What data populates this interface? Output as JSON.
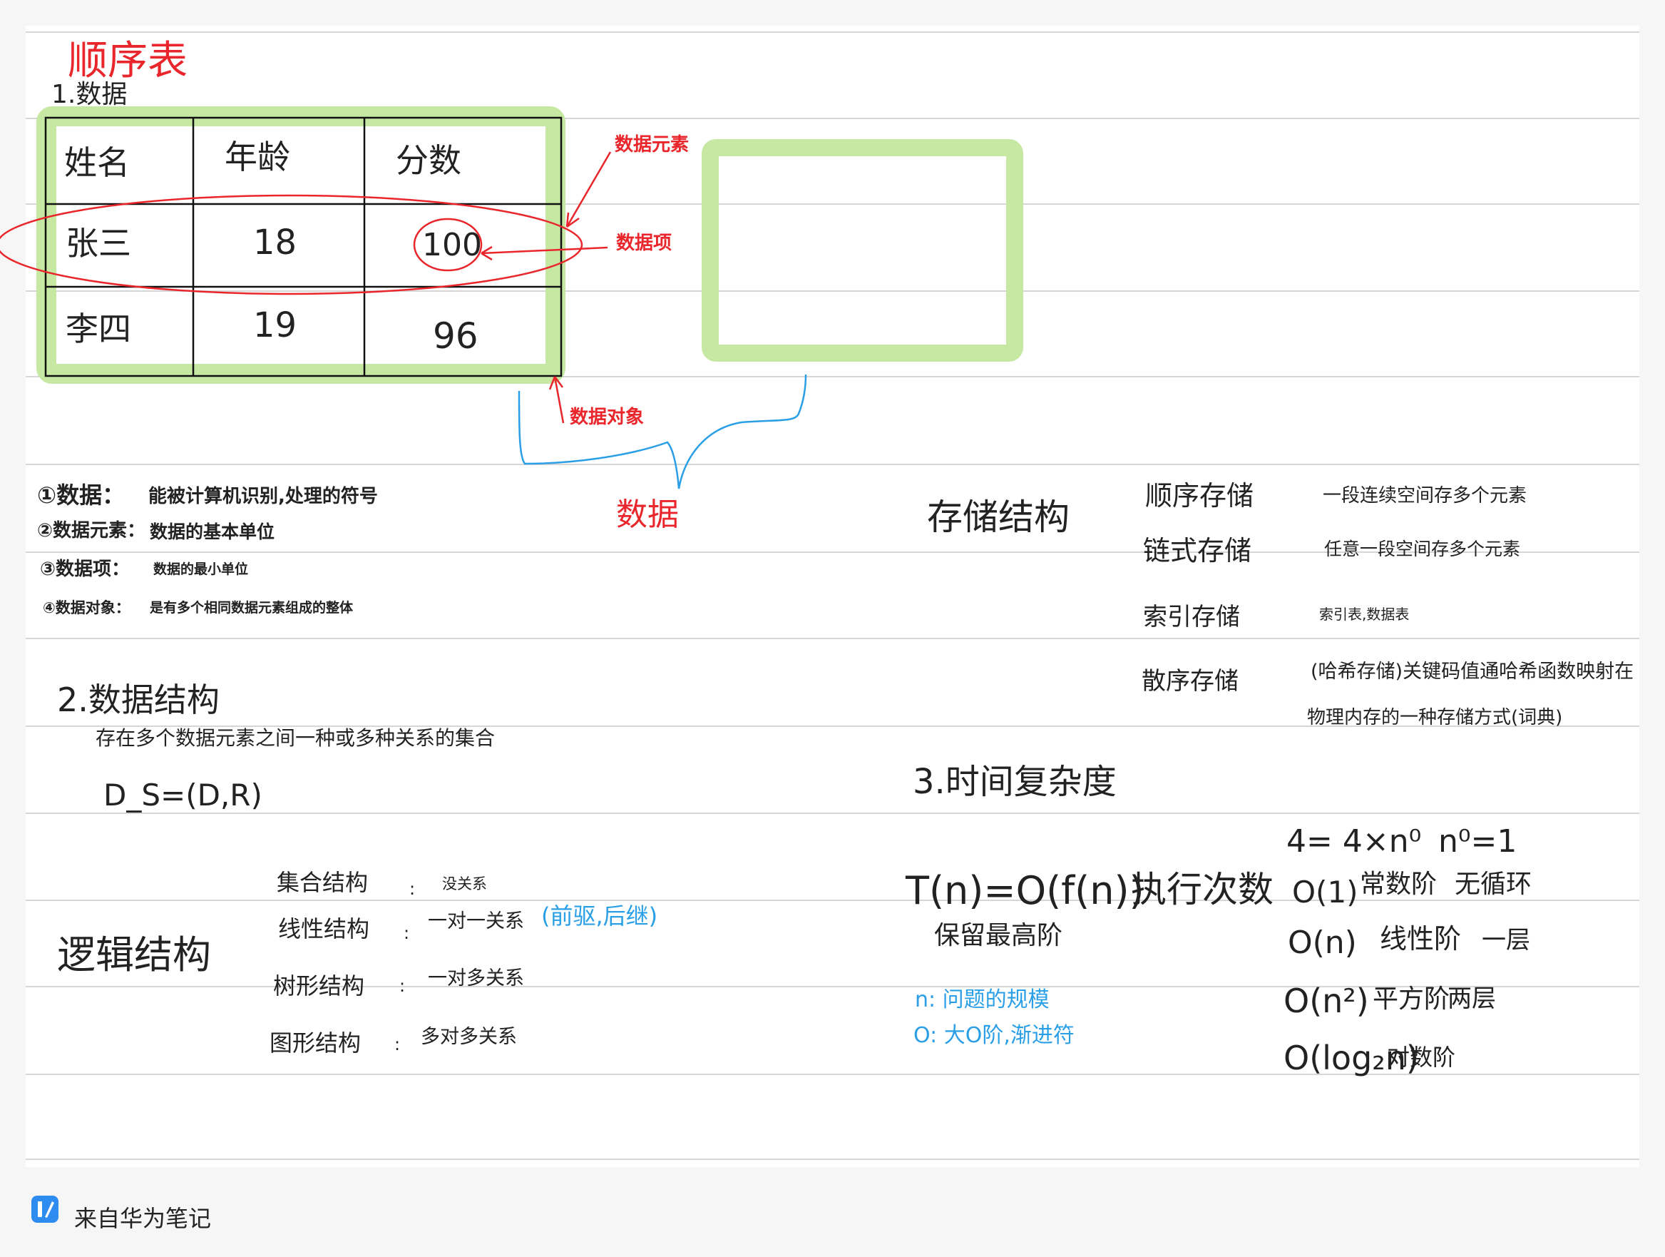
{
  "title": "顺序表",
  "section1": "1.数据",
  "table": {
    "headers": [
      "姓名",
      "年龄",
      "分数"
    ],
    "rows": [
      [
        "张三",
        "18",
        "100"
      ],
      [
        "李四",
        "19",
        "96"
      ]
    ]
  },
  "annotations": {
    "element": "数据元素",
    "item": "数据项",
    "object": "数据对象",
    "data": "数据"
  },
  "definitions": [
    {
      "term": "①数据：",
      "desc": "能被计算机识别,处理的符号"
    },
    {
      "term": "②数据元素：",
      "desc": "数据的基本单位"
    },
    {
      "term": "③数据项：",
      "desc": "数据的最小单位"
    },
    {
      "term": "④数据对象：",
      "desc": "是有多个相同数据元素组成的整体"
    }
  ],
  "storage": {
    "title": "存储结构",
    "items": [
      {
        "name": "顺序存储",
        "desc": "一段连续空间存多个元素"
      },
      {
        "name": "链式存储",
        "desc": "任意一段空间存多个元素"
      },
      {
        "name": "索引存储",
        "desc": "索引表,数据表"
      },
      {
        "name": "散序存储",
        "desc": "(哈希存储)关键码值通哈希函数映射在",
        "desc2": "物理内存的一种存储方式(词典)"
      }
    ]
  },
  "section2": {
    "title": "2.数据结构",
    "desc": "存在多个数据元素之间一种或多种关系的集合",
    "formula": "D_S=(D,R)"
  },
  "logic": {
    "title": "逻辑结构",
    "items": [
      {
        "name": "集合结构",
        "desc": "没关系"
      },
      {
        "name": "线性结构",
        "desc": "一对一关系",
        "note": "(前驱,后继)"
      },
      {
        "name": "树形结构",
        "desc": "一对多关系"
      },
      {
        "name": "图形结构",
        "desc": "多对多关系"
      }
    ]
  },
  "section3": {
    "title": "3.时间复杂度",
    "formula": "T(n)=O(f(n))",
    "formula_label": "执行次数",
    "keep": "保留最高阶",
    "note_n": "n: 问题的规模",
    "note_o": "O: 大O阶,渐进符",
    "complexity": [
      {
        "expr": "4= 4×n⁰",
        "extra": "n⁰=1"
      },
      {
        "expr": "O(1)",
        "name": "常数阶",
        "extra": "无循环"
      },
      {
        "expr": "O(n)",
        "name": "线性阶",
        "extra": "一层"
      },
      {
        "expr": "O(n²)",
        "name": "平方阶",
        "extra": "两层"
      },
      {
        "expr": "O(log₂n)",
        "name": "对数阶"
      }
    ]
  },
  "footer": "来自华为笔记",
  "colors": {
    "red": "#e8262b",
    "blue": "#2a9fe6",
    "green": "#c7e8a3"
  }
}
